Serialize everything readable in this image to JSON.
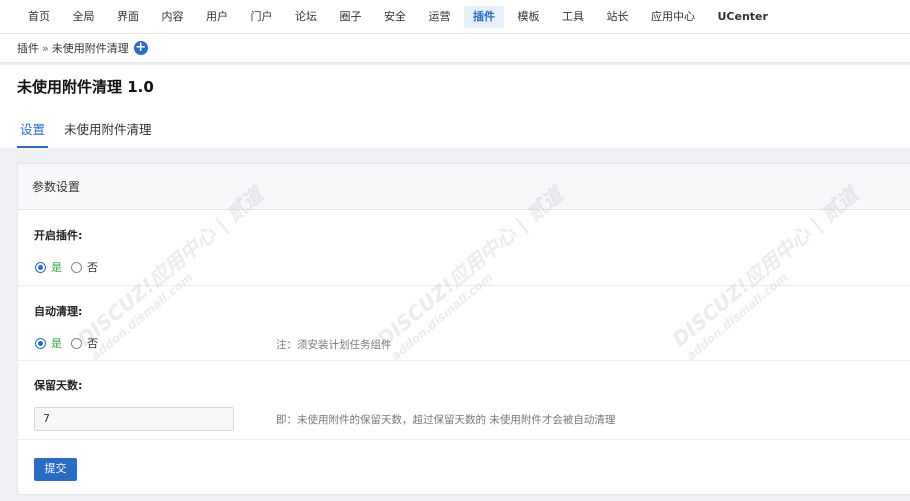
{
  "topnav": {
    "items": [
      "首页",
      "全局",
      "界面",
      "内容",
      "用户",
      "门户",
      "论坛",
      "圈子",
      "安全",
      "运营",
      "插件",
      "模板",
      "工具",
      "站长",
      "应用中心",
      "UCenter"
    ],
    "active_index": 10
  },
  "breadcrumb": {
    "parent": "插件",
    "separator": "»",
    "current": "未使用附件清理"
  },
  "page": {
    "title": "未使用附件清理 1.0"
  },
  "tabs": [
    "设置",
    "未使用附件清理"
  ],
  "panel": {
    "title": "参数设置"
  },
  "fields": {
    "enable": {
      "label": "开启插件:",
      "yes": "是",
      "no": "否",
      "selected": "是"
    },
    "auto_clean": {
      "label": "自动清理:",
      "yes": "是",
      "no": "否",
      "selected": "是",
      "note": "注：须安装计划任务组件"
    },
    "keep_days": {
      "label": "保留天数:",
      "value": "7",
      "note": "即：未使用附件的保留天数，超过保留天数的 未使用附件才会被自动清理"
    }
  },
  "submit_label": "提交",
  "watermark": {
    "text": "DISCUZ!应用中心 | 贰道",
    "sub": "addon.dismall.com"
  },
  "colors": {
    "accent": "#2a6cc4",
    "yes_green": "#3aa03a"
  }
}
